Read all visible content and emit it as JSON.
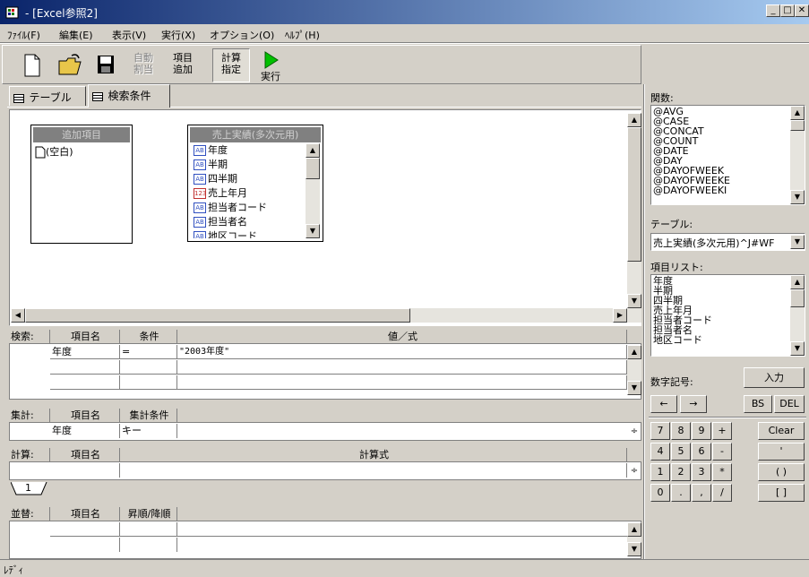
{
  "window": {
    "title": "- [Excel参照2]"
  },
  "menu": [
    "ﾌｧｲﾙ(F)",
    "編集(E)",
    "表示(V)",
    "実行(X)",
    "オプション(O)",
    "ﾍﾙﾌﾟ(H)"
  ],
  "toolbar": {
    "auto_split": "自動\n割当",
    "add_item": "項目\n追加",
    "calc_assign": "計算\n指定",
    "run": "実行"
  },
  "tabs": {
    "table": "テーブル",
    "search": "検索条件"
  },
  "design": {
    "added_box_title": "追加項目",
    "added_items": [
      "(空白)"
    ],
    "table_box_title": "売上実績(多次元用)",
    "table_fields": [
      {
        "name": "年度",
        "type": "AB"
      },
      {
        "name": "半期",
        "type": "AB"
      },
      {
        "name": "四半期",
        "type": "AB"
      },
      {
        "name": "売上年月",
        "type": "123"
      },
      {
        "name": "担当者コード",
        "type": "AB"
      },
      {
        "name": "担当者名",
        "type": "AB"
      },
      {
        "name": "地区コード",
        "type": "AB"
      }
    ]
  },
  "search": {
    "label": "検索:",
    "col_item": "項目名",
    "col_cond": "条件",
    "col_value": "値／式",
    "rows": [
      {
        "item": "年度",
        "cond": "=",
        "value": "\"2003年度\""
      }
    ]
  },
  "aggregate": {
    "label": "集計:",
    "col_item": "項目名",
    "col_cond": "集計条件",
    "rows": [
      {
        "item": "年度",
        "cond": "キー"
      }
    ]
  },
  "calc": {
    "label": "計算:",
    "col_item": "項目名",
    "col_expr": "計算式",
    "tab": "1"
  },
  "sort": {
    "label": "並替:",
    "col_item": "項目名",
    "col_order": "昇順/降順"
  },
  "right": {
    "functions_label": "関数:",
    "functions": [
      "@AVG",
      "@CASE",
      "@CONCAT",
      "@COUNT",
      "@DATE",
      "@DAY",
      "@DAYOFWEEK",
      "@DAYOFWEEKE",
      "@DAYOFWEEKI"
    ],
    "table_label": "テーブル:",
    "table_value": "売上実績(多次元用)^J#WF",
    "items_label": "項目リスト:",
    "items": [
      "年度",
      "半期",
      "四半期",
      "売上年月",
      "担当者コード",
      "担当者名",
      "地区コード"
    ],
    "numsym_label": "数字記号:",
    "input_btn": "入力",
    "arrow_left": "←",
    "arrow_right": "→",
    "bs": "BS",
    "del": "DEL",
    "keys": [
      "7",
      "8",
      "9",
      "+",
      "4",
      "5",
      "6",
      "-",
      "1",
      "2",
      "3",
      "*",
      "0",
      ".",
      ",",
      "/"
    ],
    "clear": "Clear",
    "quote": "'",
    "paren": "(  )",
    "bracket": "[  ]"
  },
  "status": "ﾚﾃﾞｨ"
}
